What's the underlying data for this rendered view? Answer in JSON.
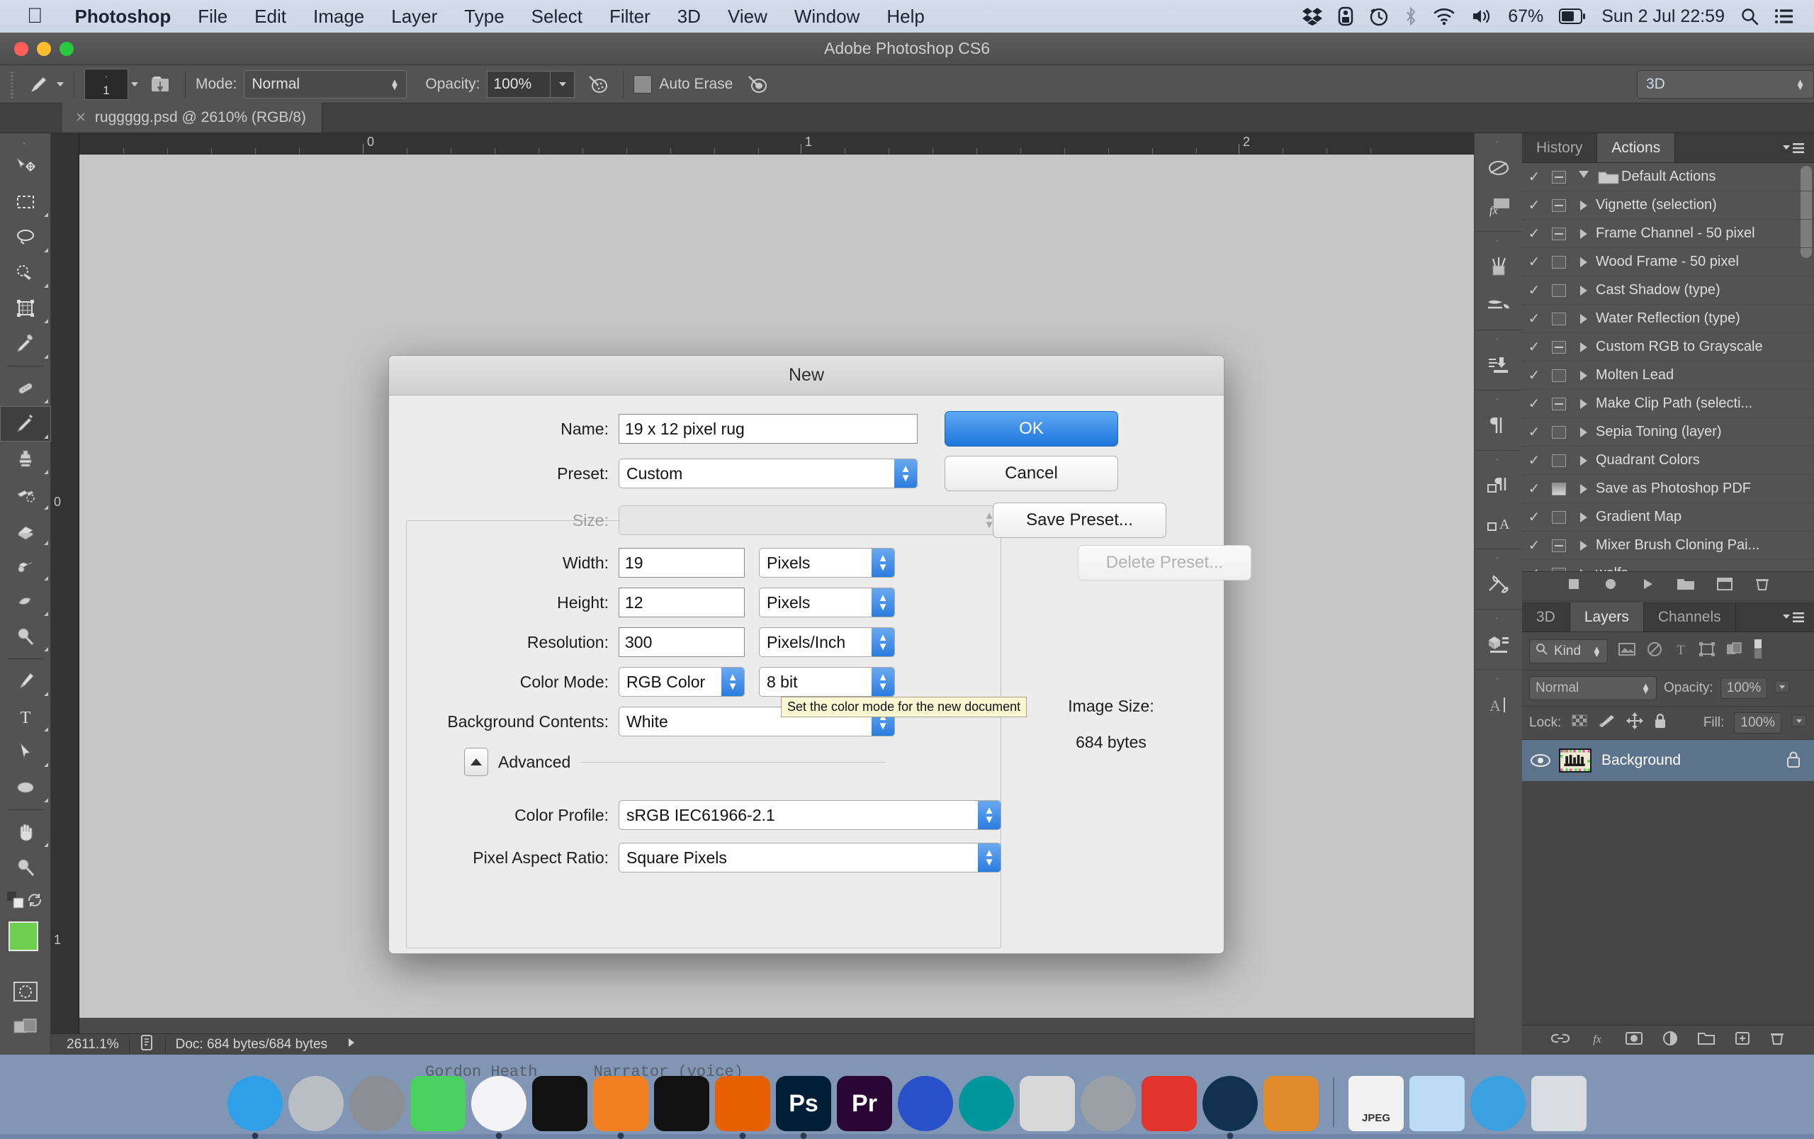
{
  "menubar": {
    "apple_icon": "apple-icon",
    "items": [
      {
        "label": "Photoshop",
        "bold": true
      },
      {
        "label": "File",
        "bold": false
      },
      {
        "label": "Edit",
        "bold": false
      },
      {
        "label": "Image",
        "bold": false
      },
      {
        "label": "Layer",
        "bold": false
      },
      {
        "label": "Type",
        "bold": false
      },
      {
        "label": "Select",
        "bold": false
      },
      {
        "label": "Filter",
        "bold": false
      },
      {
        "label": "3D",
        "bold": false
      },
      {
        "label": "View",
        "bold": false
      },
      {
        "label": "Window",
        "bold": false
      },
      {
        "label": "Help",
        "bold": false
      }
    ],
    "status": {
      "battery_percent": "67%",
      "datetime": "Sun 2 Jul 22:59",
      "icons": [
        "dropbox-icon",
        "timemachine-icon",
        "clock-icon",
        "bluetooth-icon",
        "wifi-icon",
        "volume-icon",
        "battery-icon",
        "search-icon",
        "notification-list-icon"
      ]
    }
  },
  "window": {
    "title": "Adobe Photoshop CS6",
    "traffic_lights": [
      "close-button",
      "minimize-button",
      "zoom-button"
    ]
  },
  "options_bar": {
    "tool_icon": "pencil-tool-icon",
    "brush_size": "1",
    "brush_preset_icon": "brush-preset-picker-icon",
    "mode_label": "Mode:",
    "mode_value": "Normal",
    "opacity_label": "Opacity:",
    "opacity_value": "100%",
    "airbrush_icon": "airbrush-icon",
    "pressure_icon": "tablet-pressure-icon",
    "auto_erase_label": "Auto Erase",
    "workspace_value": "3D"
  },
  "document_tab": {
    "title": "ruggggg.psd @ 2610% (RGB/8)",
    "close_icon": "close-tab-icon"
  },
  "toolbar": {
    "tools": [
      {
        "name": "move-tool",
        "glyph": "move"
      },
      {
        "name": "marquee-tool",
        "glyph": "marquee"
      },
      {
        "name": "lasso-tool",
        "glyph": "lasso"
      },
      {
        "name": "quick-selection-tool",
        "glyph": "quickselect"
      },
      {
        "name": "crop-tool",
        "glyph": "crop"
      },
      {
        "name": "eyedropper-tool",
        "glyph": "eyedropper"
      },
      {
        "name": "healing-brush-tool",
        "glyph": "healing"
      },
      {
        "name": "pencil-tool",
        "glyph": "pencil",
        "active": true
      },
      {
        "name": "clone-stamp-tool",
        "glyph": "stamp"
      },
      {
        "name": "history-brush-tool",
        "glyph": "historybrush"
      },
      {
        "name": "eraser-tool",
        "glyph": "eraser"
      },
      {
        "name": "gradient-tool",
        "glyph": "gradient"
      },
      {
        "name": "blur-tool",
        "glyph": "blur"
      },
      {
        "name": "dodge-tool",
        "glyph": "dodge"
      },
      {
        "name": "pen-tool",
        "glyph": "pen"
      },
      {
        "name": "type-tool",
        "glyph": "type"
      },
      {
        "name": "path-selection-tool",
        "glyph": "pathselect"
      },
      {
        "name": "ellipse-tool",
        "glyph": "ellipse"
      },
      {
        "name": "hand-tool",
        "glyph": "hand"
      },
      {
        "name": "zoom-tool",
        "glyph": "zoom"
      }
    ],
    "foreground_color": "#6ece4e",
    "background_color": "#ffffff",
    "quick_mask_icon": "quick-mask-icon",
    "screen_mode_icon": "screen-mode-icon"
  },
  "canvas": {
    "ruler_labels_top": [
      "0",
      "1",
      "2"
    ],
    "ruler_labels_left": [
      "0",
      "1"
    ]
  },
  "status_bar": {
    "zoom": "2611.1%",
    "doc_icon": "document-icon",
    "doc_info": "Doc: 684 bytes/684 bytes",
    "arrow_icon": "status-expand-arrow-icon"
  },
  "panel_icons": [
    {
      "name": "adjustments-panel-icon"
    },
    {
      "name": "styles-panel-icon"
    },
    {
      "name": "brush-panel-icon"
    },
    {
      "name": "brush-presets-panel-icon"
    },
    {
      "name": "clone-source-panel-icon"
    },
    {
      "name": "paragraph-panel-icon"
    },
    {
      "name": "paragraph-styles-panel-icon"
    },
    {
      "name": "character-styles-panel-icon"
    },
    {
      "name": "tool-presets-panel-icon"
    },
    {
      "name": "3d-panel-icon"
    },
    {
      "name": "character-panel-icon"
    }
  ],
  "actions_panel": {
    "tabs": [
      {
        "label": "History",
        "active": false
      },
      {
        "label": "Actions",
        "active": true
      }
    ],
    "menu_icon": "panel-menu-icon",
    "rows": [
      {
        "label": "Default Actions",
        "checked": true,
        "box": "minus",
        "tri": "down",
        "folder": true
      },
      {
        "label": "Vignette (selection)",
        "checked": true,
        "box": "minus",
        "tri": "right"
      },
      {
        "label": "Frame Channel - 50 pixel",
        "checked": true,
        "box": "minus",
        "tri": "right"
      },
      {
        "label": "Wood Frame - 50 pixel",
        "checked": true,
        "box": "empty",
        "tri": "right"
      },
      {
        "label": "Cast Shadow (type)",
        "checked": true,
        "box": "empty",
        "tri": "right"
      },
      {
        "label": "Water Reflection (type)",
        "checked": true,
        "box": "empty",
        "tri": "right"
      },
      {
        "label": "Custom RGB to Grayscale",
        "checked": true,
        "box": "minus",
        "tri": "right"
      },
      {
        "label": "Molten Lead",
        "checked": true,
        "box": "empty",
        "tri": "right"
      },
      {
        "label": "Make Clip Path (selecti...",
        "checked": true,
        "box": "minus",
        "tri": "right"
      },
      {
        "label": "Sepia Toning (layer)",
        "checked": true,
        "box": "empty",
        "tri": "right"
      },
      {
        "label": "Quadrant Colors",
        "checked": true,
        "box": "empty",
        "tri": "right"
      },
      {
        "label": "Save as Photoshop PDF",
        "checked": true,
        "box": "filled",
        "tri": "right"
      },
      {
        "label": "Gradient Map",
        "checked": true,
        "box": "empty",
        "tri": "right"
      },
      {
        "label": "Mixer Brush Cloning Pai...",
        "checked": true,
        "box": "minus",
        "tri": "right"
      },
      {
        "label": "wolfs",
        "checked": true,
        "box": "empty",
        "tri": "right"
      }
    ],
    "footer_icons": [
      "stop-icon",
      "record-icon",
      "play-icon",
      "new-set-icon",
      "new-action-icon",
      "delete-icon"
    ]
  },
  "layers_panel": {
    "tabs": [
      {
        "label": "3D",
        "active": false
      },
      {
        "label": "Layers",
        "active": true
      },
      {
        "label": "Channels",
        "active": false
      }
    ],
    "menu_icon": "panel-menu-icon",
    "filter_label": "Kind",
    "filter_icon": "search-icon",
    "filter_type_icons": [
      "pixel-filter-icon",
      "adjustment-filter-icon",
      "type-filter-icon",
      "shape-filter-icon",
      "smartobject-filter-icon"
    ],
    "filter_toggle_icon": "filter-toggle-icon",
    "blend_mode": "Normal",
    "opacity_label": "Opacity:",
    "opacity_value": "100%",
    "lock_label": "Lock:",
    "lock_icons": [
      "lock-transparent-icon",
      "lock-image-icon",
      "lock-position-icon",
      "lock-all-icon"
    ],
    "fill_label": "Fill:",
    "fill_value": "100%",
    "layers": [
      {
        "name": "Background",
        "visible": true,
        "locked": true,
        "thumb": "rug-thumbnail"
      }
    ],
    "footer_icons": [
      "link-layers-icon",
      "layer-style-fx-icon",
      "layer-mask-icon",
      "adjustment-layer-icon",
      "new-group-icon",
      "new-layer-icon",
      "delete-layer-icon"
    ]
  },
  "dialog": {
    "title": "New",
    "name_label": "Name:",
    "name_value": "19 x 12 pixel rug",
    "preset_label": "Preset:",
    "preset_value": "Custom",
    "size_label": "Size:",
    "size_value": "",
    "width_label": "Width:",
    "width_value": "19",
    "width_unit": "Pixels",
    "height_label": "Height:",
    "height_value": "12",
    "height_unit": "Pixels",
    "resolution_label": "Resolution:",
    "resolution_value": "300",
    "resolution_unit": "Pixels/Inch",
    "color_mode_label": "Color Mode:",
    "color_mode_value": "RGB Color",
    "bit_depth_value": "8 bit",
    "background_contents_label": "Background Contents:",
    "background_contents_value": "White",
    "advanced_label": "Advanced",
    "color_profile_label": "Color Profile:",
    "color_profile_value": "sRGB IEC61966-2.1",
    "pixel_aspect_label": "Pixel Aspect Ratio:",
    "pixel_aspect_value": "Square Pixels",
    "image_size_label": "Image Size:",
    "image_size_value": "684 bytes",
    "ok_label": "OK",
    "cancel_label": "Cancel",
    "save_preset_label": "Save Preset...",
    "delete_preset_label": "Delete Preset...",
    "tooltip_text": "Set the color mode for the new document"
  },
  "background_text": {
    "line": "Gordon Heath      Narrator (voice)"
  },
  "dock": {
    "items": [
      {
        "name": "finder",
        "label": "",
        "color": "#2f9fe8",
        "running": true
      },
      {
        "name": "launchpad",
        "label": "",
        "color": "#b9bec4",
        "running": false
      },
      {
        "name": "system-preferences",
        "label": "",
        "color": "#8b8f94",
        "running": false
      },
      {
        "name": "facetime",
        "label": "",
        "color": "#4ad15f",
        "running": false
      },
      {
        "name": "itunes",
        "label": "",
        "color": "#f4f4f6",
        "running": true
      },
      {
        "name": "app-black-dots",
        "label": "",
        "color": "#111111",
        "running": false
      },
      {
        "name": "vlc",
        "label": "",
        "color": "#f08020",
        "running": true
      },
      {
        "name": "audacity",
        "label": "",
        "color": "#111111",
        "running": false
      },
      {
        "name": "firefox",
        "label": "",
        "color": "#e66000",
        "running": true
      },
      {
        "name": "photoshop",
        "label": "Ps",
        "color": "#001e36",
        "running": true
      },
      {
        "name": "premiere",
        "label": "Pr",
        "color": "#2a0634",
        "running": false
      },
      {
        "name": "blender-like",
        "label": "",
        "color": "#2850c8",
        "running": false
      },
      {
        "name": "arduino",
        "label": "",
        "color": "#00979c",
        "running": false
      },
      {
        "name": "calculator",
        "label": "",
        "color": "#d8d8d8",
        "running": false
      },
      {
        "name": "disk-utility",
        "label": "",
        "color": "#9aa0a6",
        "running": false
      },
      {
        "name": "sketchup",
        "label": "",
        "color": "#e2342c",
        "running": false
      },
      {
        "name": "steam",
        "label": "",
        "color": "#12304f",
        "running": true
      },
      {
        "name": "kerbal-space-program",
        "label": "",
        "color": "#e08b2c",
        "running": false
      },
      {
        "name": "jpeg-file",
        "label": "JPEG",
        "color": "#f2f2f2",
        "running": false
      },
      {
        "name": "folder-stack",
        "label": "",
        "color": "#bcdcf5",
        "running": false
      },
      {
        "name": "internet-globe",
        "label": "",
        "color": "#3aa0e0",
        "running": false
      },
      {
        "name": "trash",
        "label": "",
        "color": "#d9dde2",
        "running": false
      }
    ]
  }
}
